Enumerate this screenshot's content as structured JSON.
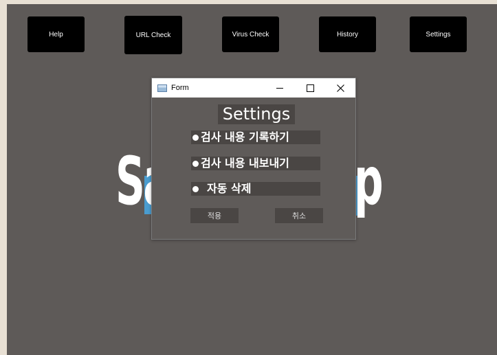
{
  "nav": {
    "help": "Help",
    "url_check": "URL Check",
    "virus_check": "Virus Check",
    "history": "History",
    "settings": "Settings"
  },
  "hero": {
    "left_text": "Sa",
    "right_text": "p"
  },
  "dialog": {
    "window_title": "Form",
    "heading": "Settings",
    "options": [
      {
        "label": "검사 내용 기록하기"
      },
      {
        "label": "검사 내용 내보내기"
      },
      {
        "label": "자동 삭제"
      }
    ],
    "apply_label": "적용",
    "cancel_label": "취소"
  },
  "colors": {
    "app_background": "#5e5a58",
    "nav_button": "#000000",
    "dialog_control": "#4a4644",
    "accent_blue": "#4a9ccf"
  }
}
